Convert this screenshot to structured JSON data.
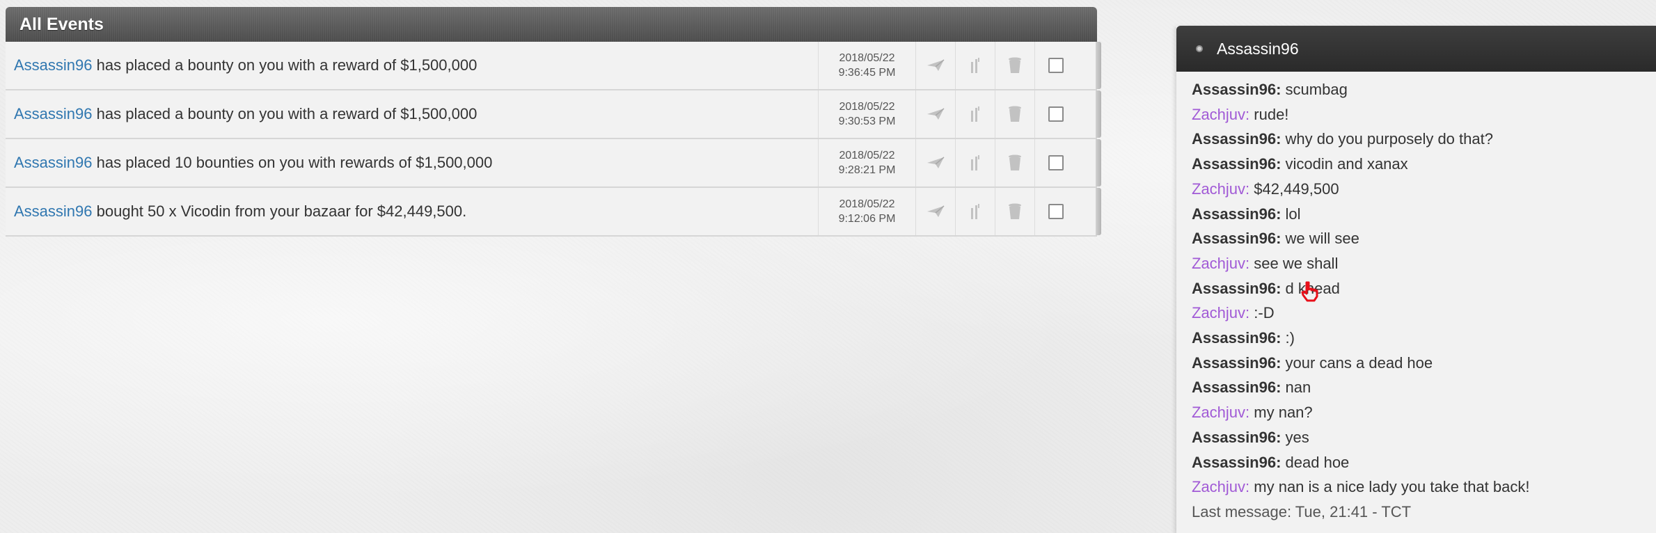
{
  "events": {
    "title": "All Events",
    "rows": [
      {
        "user": "Assassin96",
        "text": " has placed a bounty on you with a reward of $1,500,000",
        "date": "2018/05/22",
        "time": "9:36:45 PM"
      },
      {
        "user": "Assassin96",
        "text": " has placed a bounty on you with a reward of $1,500,000",
        "date": "2018/05/22",
        "time": "9:30:53 PM"
      },
      {
        "user": "Assassin96",
        "text": " has placed 10 bounties on you with rewards of $1,500,000",
        "date": "2018/05/22",
        "time": "9:28:21 PM"
      },
      {
        "user": "Assassin96",
        "text": " bought 50 x Vicodin from your bazaar for $42,449,500.",
        "date": "2018/05/22",
        "time": "9:12:06 PM"
      }
    ],
    "actions": [
      "send-icon",
      "report-icon",
      "trash-icon",
      "checkbox"
    ]
  },
  "chat": {
    "title": "Assassin96",
    "messages": [
      {
        "sender": "Assassin96:",
        "text": " scumbag",
        "self": false
      },
      {
        "sender": "Zachjuv:",
        "text": " rude!",
        "self": true
      },
      {
        "sender": "Assassin96:",
        "text": " why do you purposely do that?",
        "self": false
      },
      {
        "sender": "Assassin96:",
        "text": " vicodin and xanax",
        "self": false
      },
      {
        "sender": "Zachjuv:",
        "text": " $42,449,500",
        "self": true
      },
      {
        "sender": "Assassin96:",
        "text": " lol",
        "self": false
      },
      {
        "sender": "Assassin96:",
        "text": " we will see",
        "self": false
      },
      {
        "sender": "Zachjuv:",
        "text": " see we shall",
        "self": true
      },
      {
        "sender": "Assassin96:",
        "text": " d  khead",
        "self": false
      },
      {
        "sender": "Zachjuv:",
        "text": " :-D",
        "self": true
      },
      {
        "sender": "Assassin96:",
        "text": " :)",
        "self": false
      },
      {
        "sender": "Assassin96:",
        "text": " your cans a dead hoe",
        "self": false
      },
      {
        "sender": "Assassin96:",
        "text": " nan",
        "self": false
      },
      {
        "sender": "Zachjuv:",
        "text": " my nan?",
        "self": true
      },
      {
        "sender": "Assassin96:",
        "text": " yes",
        "self": false
      },
      {
        "sender": "Assassin96:",
        "text": " dead hoe",
        "self": false
      },
      {
        "sender": "Zachjuv:",
        "text": " my nan is a nice lady you take that back!",
        "self": true
      }
    ],
    "last_message": "Last message: Tue, 21:41 - TCT"
  },
  "colors": {
    "user_link": "#3077b0",
    "self_sender": "#a15ad6",
    "cursor": "#e8101a"
  }
}
